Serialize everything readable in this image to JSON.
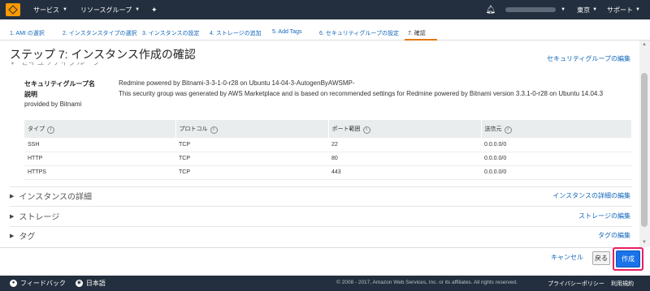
{
  "topnav": {
    "services_label": "サービス",
    "resource_groups_label": "リソースグループ",
    "region_label": "東京",
    "support_label": "サポート"
  },
  "wizard": {
    "tabs": [
      "1. AMI の選択",
      "2. インスタンスタイプの選択",
      "3. インスタンスの設定",
      "4. ストレージの追加",
      "5. Add Tags",
      "6. セキュリティグループの設定",
      "7. 確認"
    ]
  },
  "page": {
    "title": "ステップ 7: インスタンス作成の確認",
    "security_section_title": "セキュリティグループ",
    "security_edit_link": "セキュリティグループの編集"
  },
  "security_group": {
    "name_label": "セキュリティグループ名",
    "name_value": "Redmine powered by Bitnami-3-3-1-0-r28 on Ubuntu 14-04-3-AutogenByAWSMP-",
    "description_label": "説明",
    "description_value": "This security group was generated by AWS Marketplace and is based on recommended settings for Redmine powered by Bitnami version 3.3.1-0-r28 on Ubuntu 14.04.3",
    "provided_by": "provided by Bitnami"
  },
  "rules_table": {
    "headers": [
      "タイプ",
      "プロトコル",
      "ポート範囲",
      "送信元"
    ],
    "rows": [
      [
        "SSH",
        "TCP",
        "22",
        "0.0.0.0/0"
      ],
      [
        "HTTP",
        "TCP",
        "80",
        "0.0.0.0/0"
      ],
      [
        "HTTPS",
        "TCP",
        "443",
        "0.0.0.0/0"
      ]
    ]
  },
  "sections": [
    {
      "title": "インスタンスの詳細",
      "edit": "インスタンスの詳細の編集"
    },
    {
      "title": "ストレージ",
      "edit": "ストレージの編集"
    },
    {
      "title": "タグ",
      "edit": "タグの編集"
    }
  ],
  "buttons": {
    "cancel": "キャンセル",
    "back": "戻る",
    "create": "作成"
  },
  "footer": {
    "feedback": "フィードバック",
    "language": "日本語",
    "copyright": "© 2008 - 2017, Amazon Web Services, Inc. or its affiliates. All rights reserved.",
    "privacy": "プライバシーポリシー",
    "terms": "利用規約"
  },
  "colors": {
    "nav_bg": "#232f3e",
    "link": "#1166bb",
    "primary_button": "#1a73e8",
    "highlight_frame": "#e91e63"
  }
}
